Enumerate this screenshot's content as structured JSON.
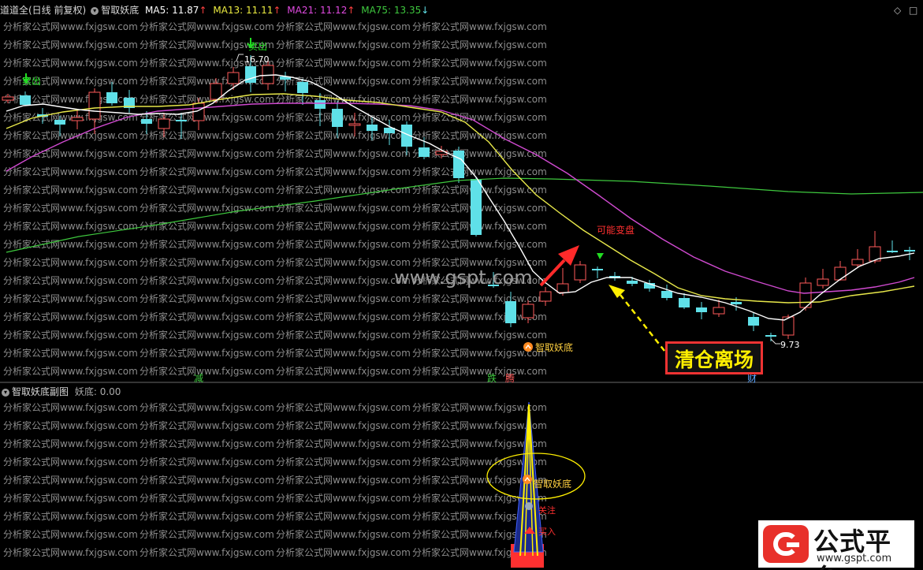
{
  "main_header": {
    "title": "道道全(日线 前复权)",
    "indicator": "智取妖底",
    "ma5": "MA5: 11.87",
    "ma13": "MA13: 11.11",
    "ma21": "MA21: 11.12",
    "ma75": "MA75: 13.35",
    "ma5_arrow": "↑",
    "ma13_arrow": "↑",
    "ma21_arrow": "↑",
    "ma75_arrow": "↓"
  },
  "sub_header": {
    "title": "智取妖底副图",
    "value": "妖底: 0.00"
  },
  "annotations": {
    "sell_1": "卖出",
    "sell_2": "卖出",
    "high_price": "16.70",
    "low_price": "9.73",
    "may_reverse": "可能变盘",
    "yaodi_main": "智取妖底",
    "clear_exit": "清仓离场",
    "watermark_center": "www.gspt.com",
    "mark_jian": "减",
    "mark_die": "跌",
    "mark_teng": "腾",
    "mark_cai": "财",
    "sub_yaodi": "智取妖底",
    "sub_focus": "关注",
    "sub_buy": "买入"
  },
  "watermark_text": "分析家公式网www.fxjgsw.com",
  "logo": {
    "title": "公式平台",
    "url": "www.gspt.com"
  },
  "colors": {
    "up": "#ff5a5a",
    "down": "#5fe0e8",
    "ma5": "#ffffff",
    "ma13": "#e8e84a",
    "ma21": "#d04ad0",
    "ma75": "#3ec83e",
    "signal_sell": "#22dd22",
    "arrow_red": "#ff3030",
    "highlight": "#ffef00"
  },
  "chart_data": {
    "type": "candlestick",
    "title": "道道全(日线 前复权)",
    "series": [
      {
        "name": "MA5",
        "last": 11.87
      },
      {
        "name": "MA13",
        "last": 11.11
      },
      {
        "name": "MA21",
        "last": 11.12
      },
      {
        "name": "MA75",
        "last": 13.35
      }
    ],
    "marked_high": 16.7,
    "marked_low": 9.73
  }
}
